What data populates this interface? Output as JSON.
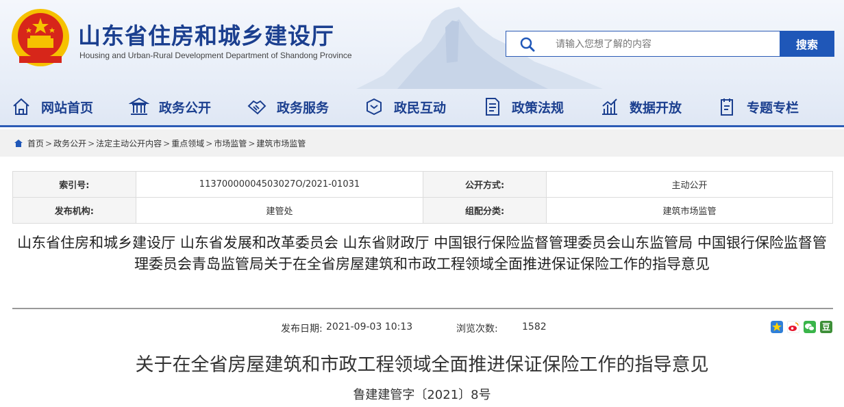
{
  "site": {
    "title": "山东省住房和城乡建设厅",
    "subtitle": "Housing and Urban-Rural Development Department of Shandong Province"
  },
  "search": {
    "placeholder": "请输入您想了解的内容",
    "button_label": "搜索"
  },
  "nav": [
    {
      "label": "网站首页",
      "icon": "home-icon"
    },
    {
      "label": "政务公开",
      "icon": "government-building-icon"
    },
    {
      "label": "政务服务",
      "icon": "handshake-icon"
    },
    {
      "label": "政民互动",
      "icon": "interaction-icon"
    },
    {
      "label": "政策法规",
      "icon": "document-icon"
    },
    {
      "label": "数据开放",
      "icon": "data-chart-icon"
    },
    {
      "label": "专题专栏",
      "icon": "topic-icon"
    }
  ],
  "breadcrumb": [
    "首页",
    "政务公开",
    "法定主动公开内容",
    "重点领域",
    "市场监管",
    "建筑市场监管"
  ],
  "info": {
    "index_label": "索引号:",
    "index_value": "11370000004503027O/2021-01031",
    "open_label": "公开方式:",
    "open_value": "主动公开",
    "org_label": "发布机构:",
    "org_value": "建管处",
    "category_label": "组配分类:",
    "category_value": "建筑市场监管"
  },
  "doc_title": "山东省住房和城乡建设厅 山东省发展和改革委员会 山东省财政厅 中国银行保险监督管理委员会山东监管局 中国银行保险监督管理委员会青岛监管局关于在全省房屋建筑和市政工程领域全面推进保证保险工作的指导意见",
  "meta": {
    "date_label": "发布日期:",
    "date_value": "2021-09-03 10:13",
    "views_label": "浏览次数:",
    "views_value": "1582"
  },
  "share_icons": [
    "qzone-share-icon",
    "weibo-share-icon",
    "wechat-share-icon",
    "douban-share-icon"
  ],
  "share_douban_char": "豆",
  "main_title": "关于在全省房屋建筑和市政工程领域全面推进保证保险工作的指导意见",
  "doc_number": "鲁建建管字〔2021〕8号",
  "colors": {
    "brand_blue": "#1b3f8f",
    "button_blue": "#1f57b8",
    "emblem_red": "#d7261a",
    "emblem_gold": "#f6c200"
  }
}
